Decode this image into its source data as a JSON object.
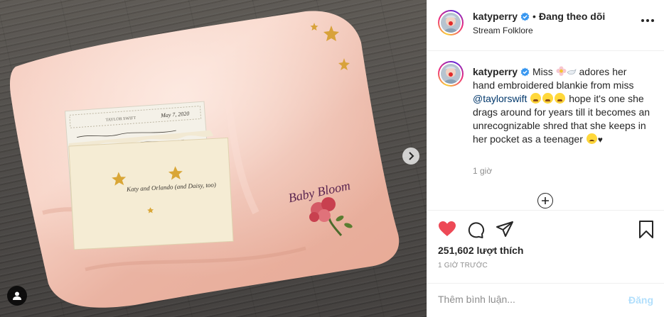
{
  "post": {
    "username": "katyperry",
    "separator": "•",
    "follow_label": "Đang theo dõi",
    "location": "Stream Folklore",
    "more_icon": "more-dots-icon"
  },
  "caption": {
    "username": "katyperry",
    "part1": "Miss",
    "part2": "adores her hand embroidered blankie from miss",
    "mention": "@taylorswift",
    "part3": "hope it's one she drags around for years till it becomes an unrecognizable shred that she keeps in her pocket as a teenager",
    "heart": "♥",
    "time": "1 giờ"
  },
  "photo": {
    "card_header": "TAYLOR SWIFT",
    "card_date": "May 7, 2020",
    "envelope_text": "Katy and Orlando (and Daisy, too)",
    "embroidery": "Baby Bloom"
  },
  "actions": {
    "likes": "251,602 lượt thích",
    "time_ago": "1 GIỜ TRƯỚC",
    "comment_placeholder": "Thêm bình luận...",
    "post_label": "Đăng"
  },
  "colors": {
    "heart_red": "#ed4956",
    "verified_blue": "#3897f0",
    "mention_blue": "#00376b",
    "post_disabled": "#b2dffc"
  }
}
